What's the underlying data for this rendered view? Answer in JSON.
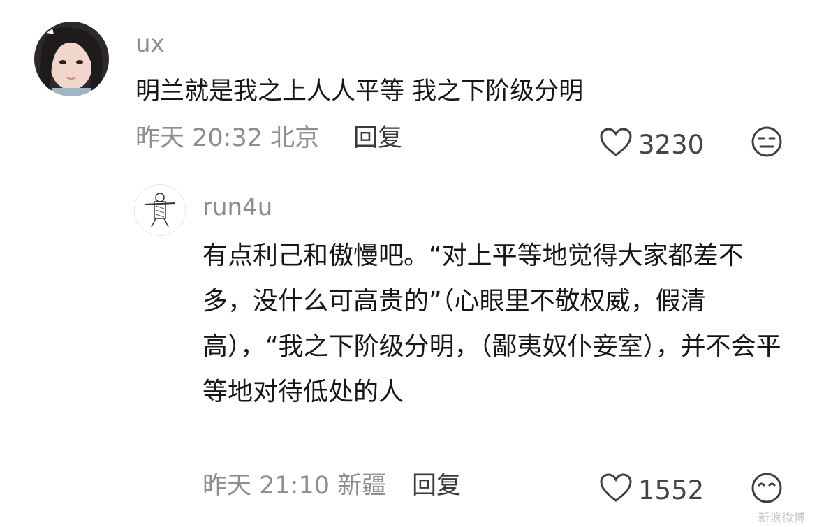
{
  "comment": {
    "username": "ux",
    "text": "明兰就是我之上人人平等 我之下阶级分明",
    "meta": "昨天 20:32 北京",
    "reply_label": "回复",
    "likes": "3230",
    "react_icon": "neutral-face-icon"
  },
  "reply": {
    "username": "run4u",
    "text": "有点利己和傲慢吧。“对上平等地觉得大家都差不多，没什么可高贵的”（心眼里不敬权威，假清高），“我之下阶级分明，（鄙夷奴仆妾室），并不会平等地对待低处的人",
    "meta": "昨天 21:10 新疆",
    "reply_label": "回复",
    "likes": "1552",
    "react_icon": "face-icon"
  },
  "watermark": "新浪微博"
}
